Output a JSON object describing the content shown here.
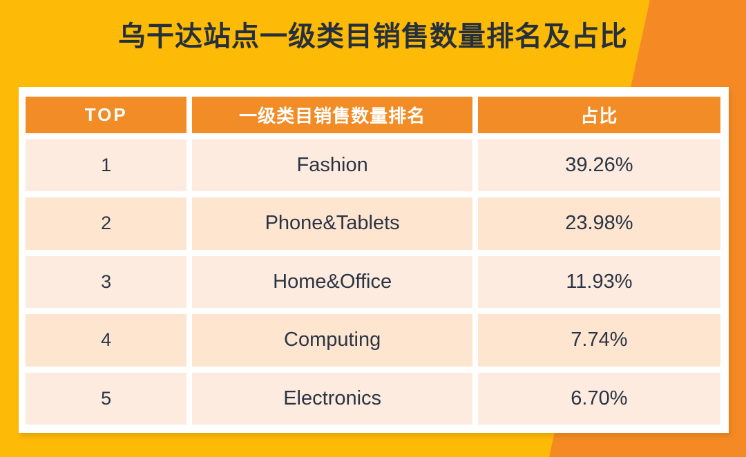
{
  "page": {
    "title": "乌干达站点一级类目销售数量排名及占比"
  },
  "colors": {
    "background_gold": "#FDBA06",
    "background_orange": "#F58A24",
    "header_orange": "#F28C26",
    "row_light": "#FCEBDE",
    "row_dark": "#FDE5D0",
    "text_dark": "#2B3445",
    "title_text": "#26303D",
    "card_white": "#FFFFFF"
  },
  "table": {
    "columns": [
      {
        "key": "rank",
        "label": "TOP"
      },
      {
        "key": "name",
        "label": "一级类目销售数量排名"
      },
      {
        "key": "share",
        "label": "占比"
      }
    ],
    "rows": [
      {
        "rank": "1",
        "name": "Fashion",
        "share": "39.26%"
      },
      {
        "rank": "2",
        "name": "Phone&Tablets",
        "share": "23.98%"
      },
      {
        "rank": "3",
        "name": "Home&Office",
        "share": "11.93%"
      },
      {
        "rank": "4",
        "name": "Computing",
        "share": "7.74%"
      },
      {
        "rank": "5",
        "name": "Electronics",
        "share": "6.70%"
      }
    ]
  }
}
